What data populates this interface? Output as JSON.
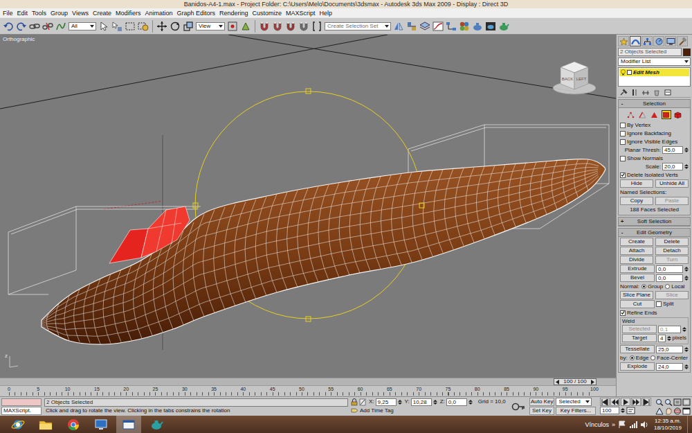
{
  "window": {
    "title": "Banidos-A4-1.max - Project Folder: C:\\Users\\Melo\\Documents\\3dsmax - Autodesk 3ds Max 2009 - Display : Direct 3D"
  },
  "menu": [
    "File",
    "Edit",
    "Tools",
    "Group",
    "Views",
    "Create",
    "Modifiers",
    "Animation",
    "Graph Editors",
    "Rendering",
    "Customize",
    "MAXScript",
    "Help"
  ],
  "toolbar": {
    "filter": "All",
    "coordinate_system": "View",
    "selection_set": "Create Selection Set"
  },
  "viewport": {
    "label": "Orthographic",
    "viewcube": {
      "front_face": "BACK",
      "side_face": "LEFT"
    },
    "axis_label": "z"
  },
  "command_panel": {
    "tabs": [
      {
        "selected": false
      },
      {
        "selected": true
      },
      {
        "selected": false
      },
      {
        "selected": false
      },
      {
        "selected": false
      },
      {
        "selected": false
      }
    ],
    "object_name": "2 Objects Selected",
    "object_color": "#4d1f08",
    "modifier_list": "Modifier List",
    "stack": [
      {
        "label": "Edit Mesh",
        "selected": true,
        "on": true
      }
    ],
    "rollouts": [
      {
        "sign": "-",
        "title": "Selection",
        "expanded": true,
        "rows": [
          {
            "kind": "subobjects",
            "items": [
              {
                "selected": false
              },
              {
                "selected": false
              },
              {
                "selected": false
              },
              {
                "selected": true
              },
              {
                "selected": false
              }
            ]
          },
          {
            "kind": "check",
            "label": "By Vertex",
            "checked": false
          },
          {
            "kind": "check",
            "label": "Ignore Backfacing",
            "checked": false
          },
          {
            "kind": "check",
            "label": "Ignore Visible Edges",
            "checked": false
          },
          {
            "kind": "spinner",
            "label": "Planar Thresh:",
            "value": "45,0"
          },
          {
            "kind": "check",
            "label": "Show Normals",
            "checked": false
          },
          {
            "kind": "spinner",
            "label": "Scale:",
            "value": "20,0"
          },
          {
            "kind": "check",
            "label": "Delete Isolated Verts",
            "checked": true
          },
          {
            "kind": "buttons",
            "items": [
              {
                "label": "Hide",
                "disabled": false
              },
              {
                "label": "Unhide All",
                "disabled": false
              }
            ]
          },
          {
            "kind": "label",
            "text": "Named Selections:"
          },
          {
            "kind": "buttons",
            "items": [
              {
                "label": "Copy",
                "disabled": false
              },
              {
                "label": "Paste",
                "disabled": true
              }
            ]
          },
          {
            "kind": "info",
            "text": "188 Faces Selected"
          }
        ]
      },
      {
        "sign": "+",
        "title": "Soft Selection",
        "expanded": false,
        "rows": []
      },
      {
        "sign": "-",
        "title": "Edit Geometry",
        "expanded": true,
        "rows": [
          {
            "kind": "buttons",
            "items": [
              {
                "label": "Create",
                "disabled": false
              },
              {
                "label": "Delete",
                "disabled": false
              }
            ]
          },
          {
            "kind": "buttons",
            "items": [
              {
                "label": "Attach",
                "disabled": false
              },
              {
                "label": "Detach",
                "disabled": false
              }
            ]
          },
          {
            "kind": "buttons",
            "items": [
              {
                "label": "Divide",
                "disabled": false
              },
              {
                "label": "Turn",
                "disabled": true
              }
            ]
          },
          {
            "kind": "button_spinner",
            "label": "Extrude",
            "disabled": false,
            "value": "0,0"
          },
          {
            "kind": "button_spinner",
            "label": "Bevel",
            "disabled": false,
            "value": "0,0"
          },
          {
            "kind": "radio",
            "label": "Normal:",
            "options": [
              {
                "label": "Group",
                "selected": true
              },
              {
                "label": "Local",
                "selected": false
              }
            ]
          },
          {
            "kind": "buttons",
            "items": [
              {
                "label": "Slice Plane",
                "disabled": false
              },
              {
                "label": "Slice",
                "disabled": true
              }
            ]
          },
          {
            "kind": "button_check",
            "label": "Cut",
            "disabled": false,
            "check": {
              "label": "Split",
              "checked": false
            }
          },
          {
            "kind": "check",
            "label": "Refine Ends",
            "checked": true
          },
          {
            "kind": "group",
            "title": "Weld",
            "rows": [
              {
                "kind": "button_spinner",
                "label": "Selected",
                "disabled": true,
                "value": "0,1"
              },
              {
                "kind": "button_spinner",
                "label": "Target",
                "disabled": false,
                "value": "4",
                "unit": "pixels"
              }
            ]
          },
          {
            "kind": "button_spinner",
            "label": "Tessellate",
            "disabled": false,
            "value": "25,0"
          },
          {
            "kind": "radio",
            "label": "by:",
            "options": [
              {
                "label": "Edge",
                "selected": true
              },
              {
                "label": "Face-Center",
                "selected": false
              }
            ]
          },
          {
            "kind": "button_spinner",
            "label": "Explode",
            "disabled": false,
            "value": "24,0"
          }
        ]
      }
    ]
  },
  "timeline": {
    "reading": "100 / 100",
    "level": 1,
    "ticks": [
      "0",
      "5",
      "10",
      "15",
      "20",
      "25",
      "30",
      "35",
      "40",
      "45",
      "50",
      "55",
      "60",
      "65",
      "70",
      "75",
      "80",
      "85",
      "90",
      "95",
      "100"
    ]
  },
  "status": {
    "script_label": "MAXScript.",
    "selection": "2 Objects Selected",
    "prompt": "Click and drag to rotate the view.  Clicking in the tabs constrains the rotation",
    "coords": [
      {
        "label": "X:",
        "value": "9,25"
      },
      {
        "label": "Y:",
        "value": "10,28"
      },
      {
        "label": "Z:",
        "value": "0,0"
      }
    ],
    "grid": "Grid = 10,0",
    "time_tag": "Add Time Tag",
    "auto_key": {
      "label": "Auto Key",
      "on": false
    },
    "key_mode": "Selected",
    "set_key": "Set Key",
    "key_filters": "Key Filters...",
    "frame": "100"
  },
  "taskbar": {
    "apps": [
      {
        "kind": "ie",
        "active": false
      },
      {
        "kind": "explorer",
        "active": false
      },
      {
        "kind": "chrome",
        "active": false
      },
      {
        "kind": "desktop",
        "active": false
      },
      {
        "kind": "window",
        "active": true
      },
      {
        "kind": "max",
        "active": false
      }
    ],
    "links": "Vínculos",
    "overflow": "»",
    "time": "12:35 a.m.",
    "date": "18/10/2019"
  }
}
